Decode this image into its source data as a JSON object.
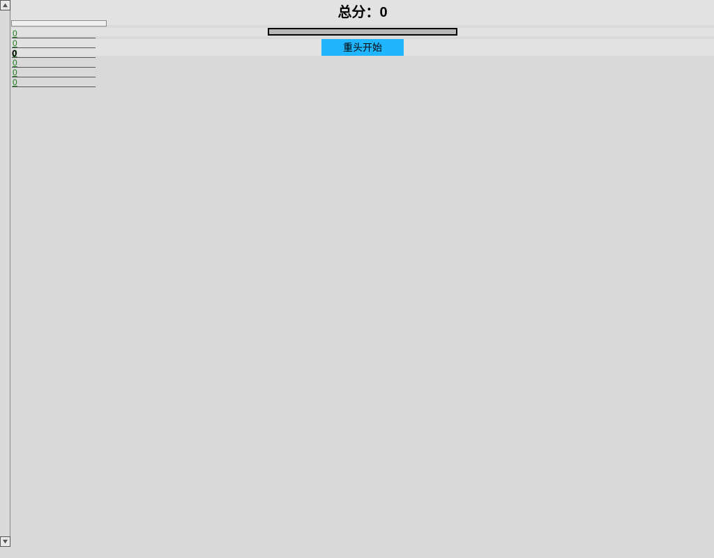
{
  "header": {
    "score_prefix": "总分：",
    "score_value": "0"
  },
  "controls": {
    "restart_label": "重头开始"
  },
  "links": {
    "items": [
      "0",
      "0",
      "0",
      "0",
      "0",
      "0"
    ],
    "overlay_value": "0"
  }
}
